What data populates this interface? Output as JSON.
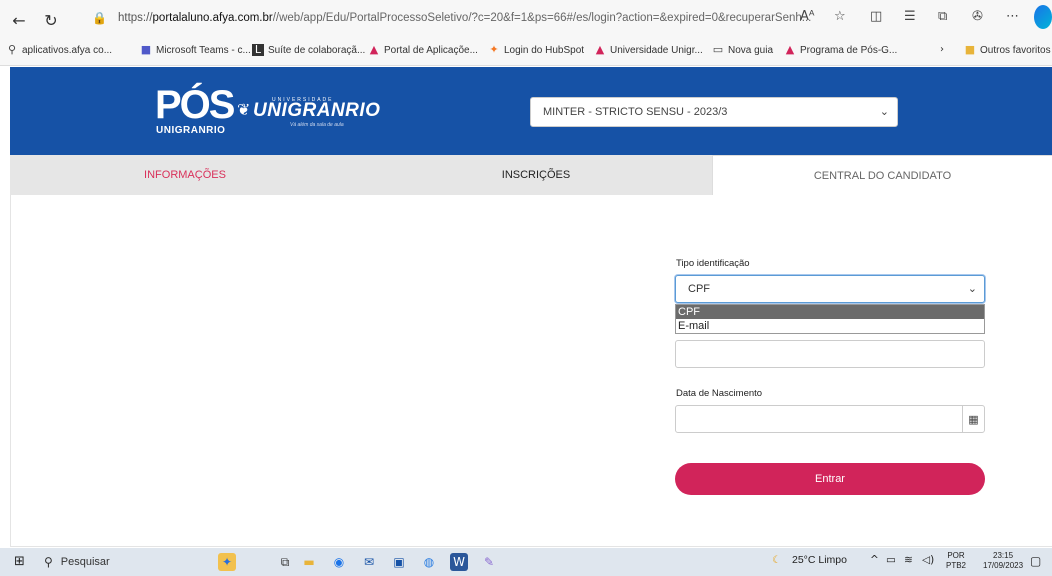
{
  "browser": {
    "url_prefix": "https://",
    "url_host": "portalaluno.afya.com.br",
    "url_rest": "//web/app/Edu/PortalProcessoSeletivo/?c=20&f=1&ps=66#/es/login?action=&expired=0&recuperarSenh...",
    "bookmarks": [
      {
        "label": "aplicativos.afya co...",
        "icon": "search-icon"
      },
      {
        "label": "Microsoft Teams - c...",
        "icon": "teams-icon"
      },
      {
        "label": "Suíte de colaboraçã...",
        "icon": "suite-icon"
      },
      {
        "label": "Portal de Aplicaçõe...",
        "icon": "afya-icon"
      },
      {
        "label": "Login do HubSpot",
        "icon": "hubspot-icon"
      },
      {
        "label": "Universidade Unigr...",
        "icon": "afya-icon"
      },
      {
        "label": "Nova guia",
        "icon": "tab-icon"
      },
      {
        "label": "Programa de Pós-G...",
        "icon": "afya-icon"
      }
    ],
    "other_favorites": "Outros favoritos"
  },
  "header": {
    "logo_pos": "PÓS",
    "logo_pos_sub": "UNIGRANRIO",
    "logo_uni_top": "UNIVERSIDADE",
    "logo_uni": "UNIGRANRIO",
    "logo_uni_sub": "Vá além da sala de aula",
    "program_select": "MINTER - STRICTO SENSU - 2023/3"
  },
  "tabs": [
    {
      "label": "INFORMAÇÕES"
    },
    {
      "label": "INSCRIÇÕES"
    },
    {
      "label": "CENTRAL DO CANDIDATO"
    }
  ],
  "form": {
    "tipo_label": "Tipo identificação",
    "tipo_value": "CPF",
    "tipo_options": [
      "CPF",
      "E-mail"
    ],
    "ident_value": "",
    "data_label": "Data de Nascimento",
    "data_value": "",
    "submit_label": "Entrar"
  },
  "taskbar": {
    "search_label": "Pesquisar",
    "weather": "25°C  Limpo",
    "lang_top": "POR",
    "lang_bottom": "PTB2",
    "time": "23:15",
    "date": "17/09/2023"
  },
  "colors": {
    "header_blue": "#1652a6",
    "accent_pink": "#d1245a",
    "tab_active_text": "#d9305a"
  }
}
